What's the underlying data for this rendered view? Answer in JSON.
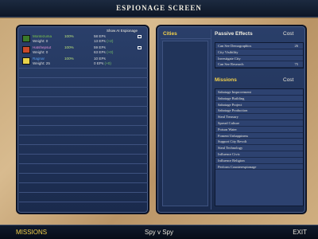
{
  "window": {
    "title": "ESPIONAGE SCREEN"
  },
  "left_panel": {
    "show_ai_label": "Show AI Espionage",
    "spies": [
      {
        "name": "Montezuma",
        "percent": "100%",
        "weight": "Weight: 0",
        "eps": "58 EPs",
        "eps_rate": "13 EPs",
        "eps_inc": "(+2)",
        "flag_color": "#3a7a2a",
        "name_color": "#7ec84a"
      },
      {
        "name": "Hatshepsut",
        "percent": "100%",
        "weight": "Weight: 0",
        "eps": "59 EPs",
        "eps_rate": "63 EPs",
        "eps_inc": "(+0)",
        "flag_color": "#c84a2a",
        "name_color": "#e08fd6"
      },
      {
        "name": "Ragnar",
        "percent": "100%",
        "weight": "Weight: 25",
        "eps": "10 EPs",
        "eps_rate": "0 EPs",
        "eps_inc": "(+0)",
        "flag_color": "#e8d24a",
        "name_color": "#5aa0f0"
      }
    ]
  },
  "right_panel": {
    "cities_title": "Cities",
    "passive_title": "Passive Effects",
    "passive_cost_title": "Cost",
    "passive_effects": [
      {
        "label": "Can See Demographics",
        "cost": "26"
      },
      {
        "label": "City Visibility",
        "cost": ""
      },
      {
        "label": "Investigate City",
        "cost": ""
      },
      {
        "label": "Can See Research",
        "cost": "75"
      }
    ],
    "missions_title": "Missions",
    "missions_cost_title": "Cost",
    "missions": [
      "Sabotage Improvement",
      "Sabotage Building",
      "Sabotage Project",
      "Sabotage Production",
      "Steal Treasury",
      "Spread Culture",
      "Poison Water",
      "Foment Unhappiness",
      "Support City Revolt",
      "Steal Technology",
      "Influence Civic",
      "Influence Religion",
      "Perform Counterespionage"
    ]
  },
  "bottom_bar": {
    "missions_label": "MISSIONS",
    "spy_vs_spy_label": "Spy v Spy",
    "exit_label": "EXIT"
  },
  "colors": {
    "accent_yellow": "#f5d24a",
    "panel_blue": "#2a3f6a",
    "parchment": "#c9a97a"
  }
}
